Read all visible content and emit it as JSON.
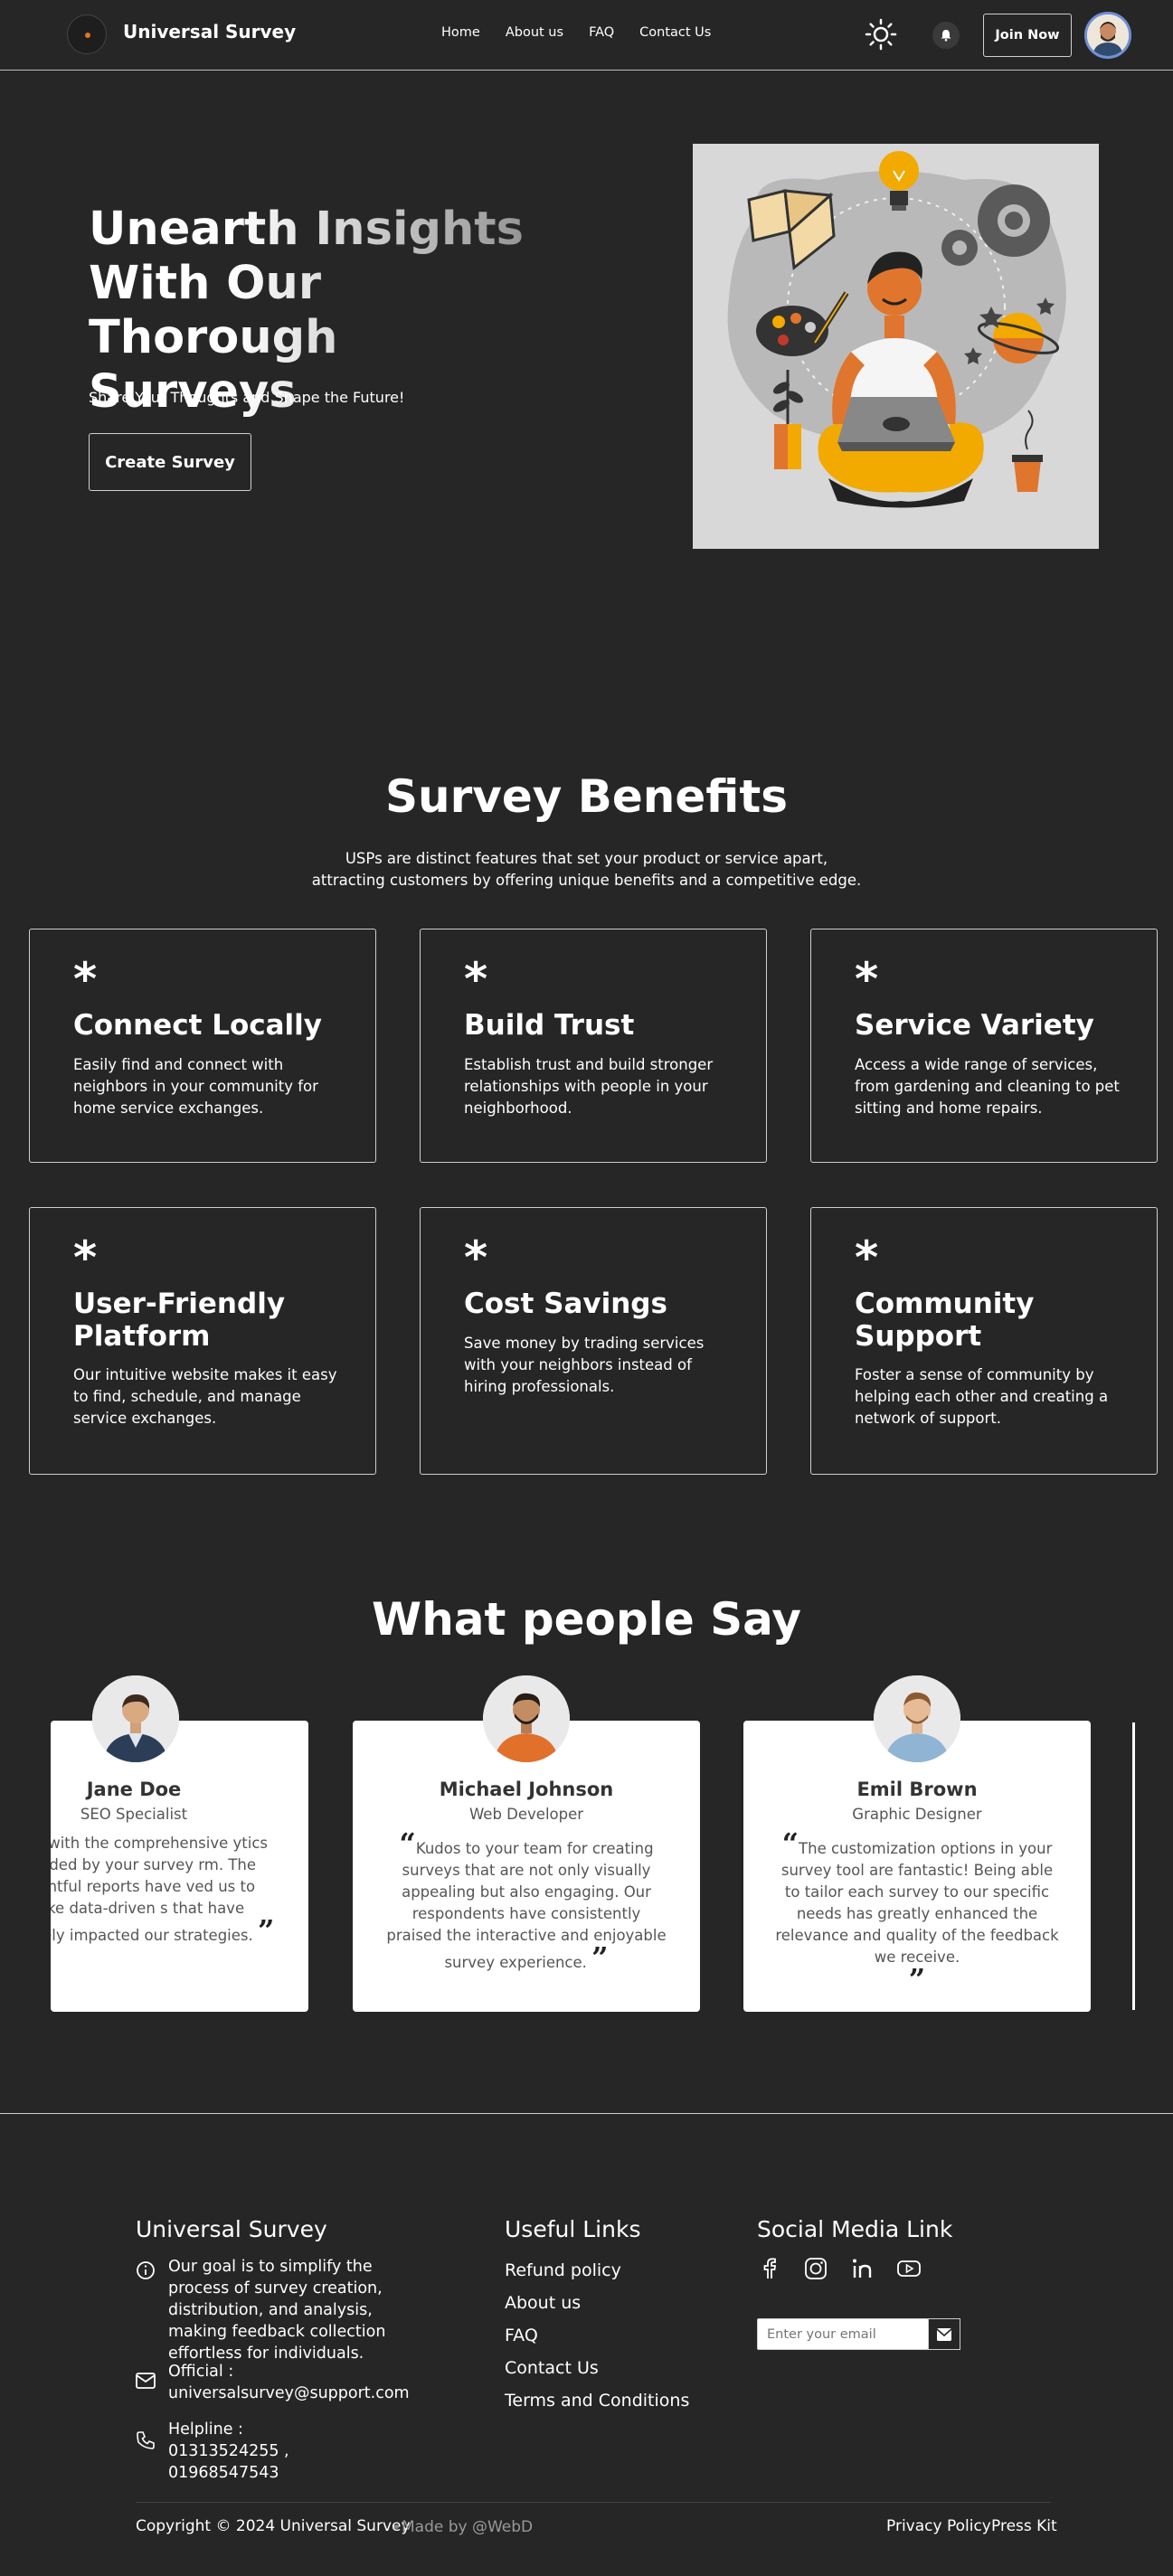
{
  "nav": {
    "brand": "Universal Survey",
    "links": [
      "Home",
      "About us",
      "FAQ",
      "Contact Us"
    ],
    "join_label": "Join Now"
  },
  "hero": {
    "title_line1": "Unearth Insights",
    "title_line2": "With Our Thorough",
    "title_line3": "Surveys",
    "subtitle": "Share Your Thoughts and Shape the Future!",
    "button": "Create Survey"
  },
  "benefits": {
    "title": "Survey Benefits",
    "subtitle": "USPs are distinct features that set your product or service apart, attracting customers by offering unique benefits and a competitive edge.",
    "cards": [
      {
        "icon": "*",
        "title": "Connect Locally",
        "text": "Easily find and connect with neighbors in your community for home service exchanges."
      },
      {
        "icon": "*",
        "title": "Build Trust",
        "text": "Establish trust and build stronger relationships with people in your neighborhood."
      },
      {
        "icon": "*",
        "title": "Service Variety",
        "text": "Access a wide range of services, from gardening and cleaning to pet sitting and home repairs."
      },
      {
        "icon": "*",
        "title": "User-Friendly Platform",
        "text": "Our intuitive website makes it easy to find, schedule, and manage service exchanges."
      },
      {
        "icon": "*",
        "title": "Cost Savings",
        "text": "Save money by trading services with your neighbors instead of hiring professionals."
      },
      {
        "icon": "*",
        "title": "Community Support",
        "text": "Foster a sense of community by helping each other and creating a network of support."
      }
    ]
  },
  "testimonials": {
    "title": "What people Say",
    "items": [
      {
        "name": "Jane Doe",
        "role": "SEO Specialist",
        "quote": "essed with the comprehensive ytics provided by your survey rm. The insightful reports have ved us to make data-driven s that have positively impacted our strategies."
      },
      {
        "name": "Michael Johnson",
        "role": "Web Developer",
        "quote": "Kudos to your team for creating surveys that are not only visually appealing but also engaging. Our respondents have consistently praised the interactive and enjoyable survey experience."
      },
      {
        "name": "Emil Brown",
        "role": "Graphic Designer",
        "quote": "The customization options in your survey tool are fantastic! Being able to tailor each survey to our specific needs has greatly enhanced the relevance and quality of the feedback we receive."
      }
    ]
  },
  "footer": {
    "brand": "Universal Survey",
    "about": "Our goal is to simplify the process of survey creation, distribution, and analysis, making feedback collection effortless for individuals.",
    "official_label": "Official :",
    "official_email": "universalsurvey@support.com",
    "helpline": "Helpline : 01313524255 , 01968547543",
    "useful_links_title": "Useful Links",
    "useful_links": [
      "Refund policy",
      "About us",
      "FAQ",
      "Contact Us",
      "Terms and Conditions"
    ],
    "social_title": "Social Media Link",
    "social_icons": [
      "facebook-icon",
      "instagram-icon",
      "linkedin-icon",
      "youtube-icon"
    ],
    "email_placeholder": "Enter your email",
    "copyright": "Copyright © 2024 Universal Survey",
    "made_by": "Made by @WebD",
    "privacy": "Privacy Policy",
    "press_kit": "Press Kit"
  },
  "colors": {
    "background": "#262626",
    "text": "#ffffff",
    "card_border": "#cfcfcf",
    "testimonial_card": "#ffffff",
    "accent_orange": "#e0752d"
  }
}
